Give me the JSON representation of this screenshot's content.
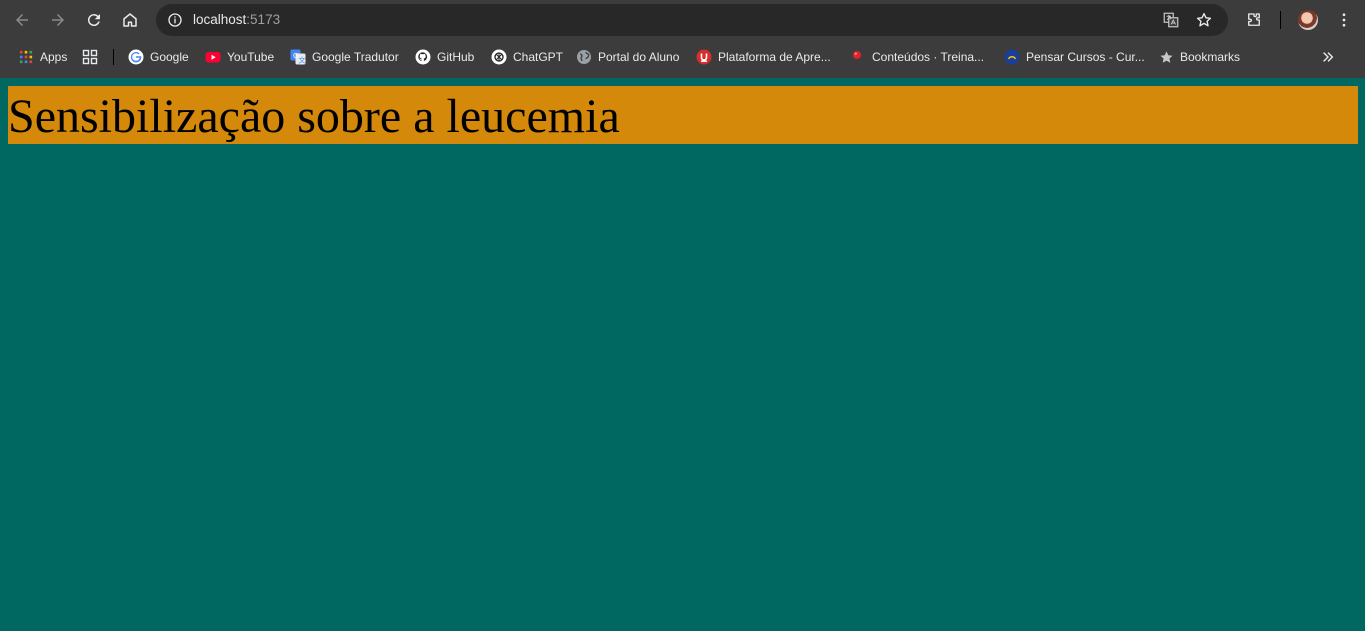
{
  "browser": {
    "url_host": "localhost",
    "url_port": ":5173",
    "bookmarks": [
      {
        "label": "Apps",
        "icon": "apps-grid-icon"
      },
      {
        "label": "",
        "icon": "tab-groups-icon"
      },
      {
        "label": "Google",
        "icon": "google-icon"
      },
      {
        "label": "YouTube",
        "icon": "youtube-icon"
      },
      {
        "label": "Google Tradutor",
        "icon": "google-translate-icon"
      },
      {
        "label": "GitHub",
        "icon": "github-icon"
      },
      {
        "label": "ChatGPT",
        "icon": "chatgpt-icon"
      },
      {
        "label": "Portal do Aluno",
        "icon": "globe-icon"
      },
      {
        "label": "Plataforma de Apre...",
        "icon": "plataforma-icon"
      },
      {
        "label": "Conteúdos · Treina...",
        "icon": "red-dot-icon"
      },
      {
        "label": "Pensar Cursos - Cur...",
        "icon": "pensar-icon"
      },
      {
        "label": "Bookmarks",
        "icon": "star-icon"
      }
    ]
  },
  "page": {
    "heading": "Sensibilização sobre a leucemia",
    "background_color": "#006861",
    "heading_bg_color": "#d4890a"
  }
}
